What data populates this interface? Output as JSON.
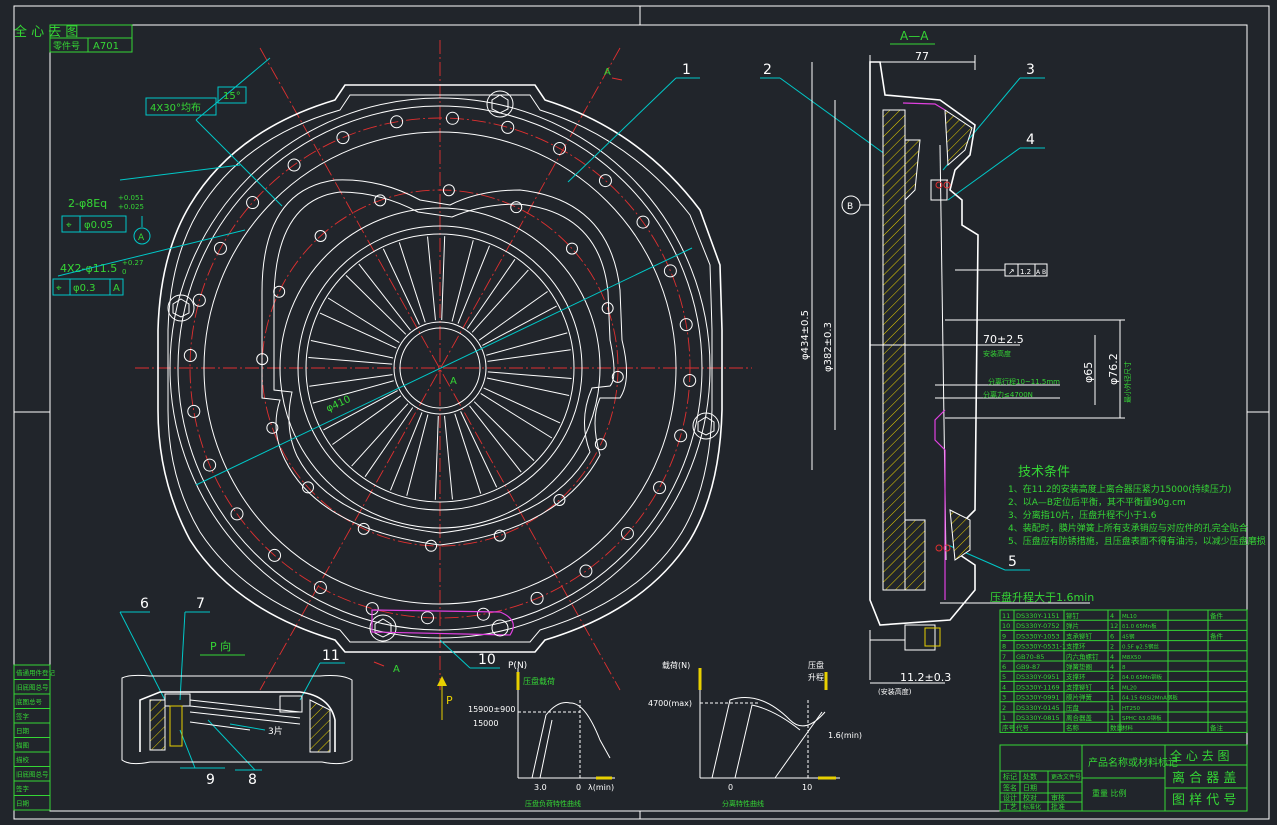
{
  "title_block_top": {
    "label": "零件号",
    "value": "A701",
    "header_text": "全 心 去 图"
  },
  "view_label": "A—A",
  "section_marks": {
    "a_top": "A",
    "a_bottom": "A",
    "center": "A"
  },
  "balloons": [
    "1",
    "2",
    "3",
    "4",
    "5",
    "6",
    "7",
    "8",
    "9",
    "10",
    "11"
  ],
  "dimensions": {
    "chamfer": "4X30°均布",
    "angle": "15°",
    "hole_pattern": "2-φ8Eq",
    "hole_tol_upper": "+0.051",
    "hole_tol_lower": "+0.025",
    "fcf1_tol": "φ0.05",
    "datum_a": "A",
    "slot_pattern": "4X2-φ11.5",
    "slot_tol_upper": "+0.27",
    "slot_tol_lower": "0",
    "fcf2_tol": "φ0.3",
    "fcf2_ref": "A",
    "circle_dia": "φ410",
    "width_77": "77",
    "dia_434": "φ434±0.5",
    "dia_382": "φ382±0.3",
    "dim_70": "70±2.5",
    "dim_70_note": "安装高度",
    "dia_65": "φ65",
    "dia_76": "φ76.2",
    "dia_76_note": "最小外径尺寸",
    "sep_travel": "分离行程10~11.5mm",
    "sep_force": "分离力≤4700N",
    "dim_11": "11.2±0.3",
    "dim_11_note": "(安装高度)",
    "runout": "1.2",
    "runout_ref": "A B",
    "plate_lift": "压盘升程大于1.6min",
    "datum_b": "B"
  },
  "tech_requirements": {
    "heading": "技术条件",
    "items": [
      "1、在11.2的安装高度上离合器压紧力15000(持续压力)",
      "2、以A—B定位后平衡，其不平衡量90g.cm",
      "3、分离指10片，压盘升程不小于1.6",
      "4、装配时，膜片弹簧上所有支承销应与对应件的孔完全贴合",
      "5、压盘应有防锈措施，且压盘表面不得有油污，以减少压盘磨损"
    ]
  },
  "detail_view": {
    "label": "P 向",
    "note": "3片"
  },
  "chart_pressure": {
    "ylabel": "P(N)",
    "legend": "压盘载荷",
    "value1": "15900±900",
    "value2": "15000",
    "x1": "3.0",
    "x2": "0",
    "xunit": "λ(min)",
    "caption": "压盘负荷特性曲线"
  },
  "chart_release": {
    "ylabel": "载荷(N)",
    "legend1": "压盘",
    "legend2": "升程",
    "value1": "4700(max)",
    "x1": "0",
    "x2": "10",
    "lift": "1.6(min)",
    "caption": "分离特性曲线"
  },
  "arrow_p": "P",
  "parts_table": {
    "rows": [
      [
        "11",
        "DS330Y-1151",
        "铆钉",
        "4",
        "ML10",
        "",
        "备件"
      ],
      [
        "10",
        "DS330Y-0752",
        "弹片",
        "12",
        "δ1.0 65Mn板",
        "",
        ""
      ],
      [
        "9",
        "DS330Y-1053",
        "支承铆钉",
        "6",
        "45钢",
        "",
        "备件"
      ],
      [
        "8",
        "DS330Y-0531-1",
        "支撑环",
        "2",
        "0.5F φ2.5钢丝",
        "",
        ""
      ],
      [
        "7",
        "GB70-85",
        "内六角螺钉",
        "4",
        "M8X50",
        "",
        ""
      ],
      [
        "6",
        "GB9-87",
        "弹簧垫圈",
        "4",
        "8",
        "",
        ""
      ],
      [
        "5",
        "DS330Y-0951",
        "支撑环",
        "2",
        "δ4.0 65Mn钢板",
        "",
        ""
      ],
      [
        "4",
        "DS330Y-1169",
        "支撑铆钉",
        "4",
        "ML20",
        "",
        ""
      ],
      [
        "3",
        "DS330Y-0991",
        "膜片弹簧",
        "1",
        "δ4.15 60Si2MnA钢板",
        "",
        ""
      ],
      [
        "2",
        "DS330Y-0145",
        "压盘",
        "1",
        "HT250",
        "",
        ""
      ],
      [
        "1",
        "DS330Y-0815",
        "离合器盖",
        "1",
        "SPHC δ3.0钢板",
        "",
        ""
      ]
    ],
    "header": [
      "序号",
      "代号",
      "名称",
      "数量",
      "材料",
      "",
      "备注"
    ]
  },
  "title_block": {
    "product_name": "产品名称或材料标记",
    "company": "全 心 去 图",
    "drawing_name": "离 合 器 盖",
    "drawing_no": "图 样 代 号",
    "weight_scale": "重量  比例",
    "labels": [
      "标记",
      "处数",
      "更改文件号",
      "签名",
      "日期",
      "设计",
      "校对",
      "审核",
      "工艺",
      "标准化",
      "批准"
    ]
  },
  "left_block": {
    "items": [
      "借通用件登记",
      "旧底图总号",
      "底图总号",
      "签字",
      "日期",
      "描图",
      "描校",
      "旧底图总号",
      "签字",
      "日期"
    ]
  }
}
